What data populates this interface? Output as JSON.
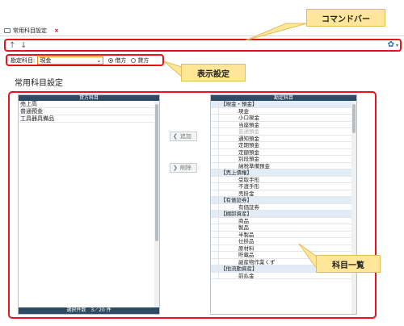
{
  "tab": {
    "title": "常用科目設定",
    "close": "×"
  },
  "cmdbar": {
    "up": "↑",
    "down": "↓",
    "gear": "✿",
    "gear_dropdown": "▾"
  },
  "display": {
    "label": "勘定科目:",
    "select_value": "現金",
    "select_arrow": "⌄",
    "radio_debit": "借方",
    "radio_credit": "貸方",
    "selected_radio": "借方"
  },
  "page_title": "常用科目設定",
  "left_panel": {
    "header": "貸方科目",
    "items": [
      "売上高",
      "普通預金",
      "工具器具備品"
    ],
    "footer": "選択件数　3／20 件"
  },
  "buttons": {
    "add": "追加",
    "delete": "削除"
  },
  "right_panel": {
    "header": "勘定科目",
    "rows": [
      {
        "label": "【現金・預金】",
        "category": true
      },
      {
        "label": "現金"
      },
      {
        "label": "小口現金"
      },
      {
        "label": "当座預金"
      },
      {
        "label": "普通預金",
        "disabled": true
      },
      {
        "label": "通知預金"
      },
      {
        "label": "定期預金"
      },
      {
        "label": "定額預金"
      },
      {
        "label": "別段預金"
      },
      {
        "label": "納税準備預金"
      },
      {
        "label": "【売上債権】",
        "category": true
      },
      {
        "label": "受取手形"
      },
      {
        "label": "不渡手形"
      },
      {
        "label": "売掛金"
      },
      {
        "label": "【有価証券】",
        "category": true
      },
      {
        "label": "有価証券"
      },
      {
        "label": "【棚卸資産】",
        "category": true
      },
      {
        "label": "商品"
      },
      {
        "label": "製品"
      },
      {
        "label": "半製品"
      },
      {
        "label": "仕掛品"
      },
      {
        "label": "原材料"
      },
      {
        "label": "貯蔵品"
      },
      {
        "label": "副産物作業くず"
      },
      {
        "label": "【他流動資産】",
        "category": true
      },
      {
        "label": "前払金"
      }
    ]
  },
  "callouts": {
    "command_bar": "コマンドバー",
    "display_settings": "表示設定",
    "account_list": "科目一覧"
  },
  "colors": {
    "annotation_red": "#e8131b",
    "callout_yellow": "#ffe699",
    "panel_header": "#2e4a63"
  }
}
